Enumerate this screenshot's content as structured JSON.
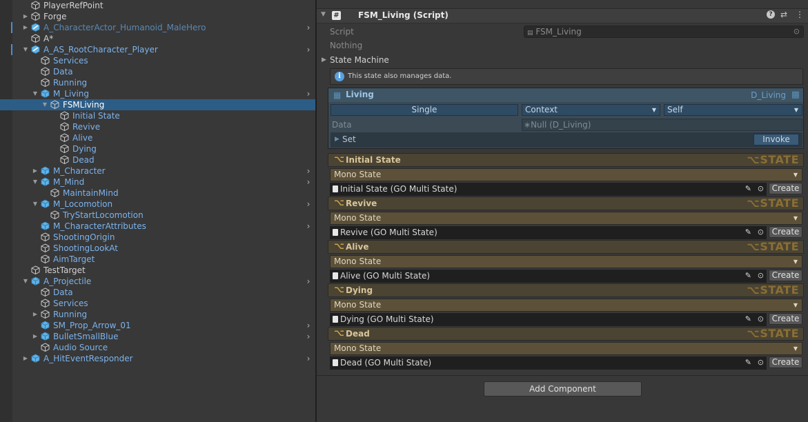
{
  "hierarchy": {
    "rows": [
      {
        "label": "PlayerRefPoint",
        "style": "normal",
        "indent": 0,
        "fold": "",
        "icon": "gameobject",
        "more": false,
        "selected": false,
        "marker": false
      },
      {
        "label": "Forge",
        "style": "normal",
        "indent": 0,
        "fold": "right",
        "icon": "gameobject",
        "more": false,
        "selected": false,
        "marker": false
      },
      {
        "label": "A_CharacterActor_Humanoid_MaleHero",
        "style": "dim",
        "indent": 0,
        "fold": "right",
        "icon": "prefab-variant",
        "more": true,
        "selected": false,
        "marker": true
      },
      {
        "label": "A*",
        "style": "normal",
        "indent": 0,
        "fold": "",
        "icon": "gameobject",
        "more": false,
        "selected": false,
        "marker": false
      },
      {
        "label": "A_AS_RootCharacter_Player",
        "style": "blue",
        "indent": 0,
        "fold": "down",
        "icon": "prefab-variant",
        "more": true,
        "selected": false,
        "marker": true
      },
      {
        "label": "Services",
        "style": "blue",
        "indent": 1,
        "fold": "",
        "icon": "gameobject",
        "more": false,
        "selected": false,
        "marker": false
      },
      {
        "label": "Data",
        "style": "blue",
        "indent": 1,
        "fold": "",
        "icon": "gameobject",
        "more": false,
        "selected": false,
        "marker": false
      },
      {
        "label": "Running",
        "style": "blue",
        "indent": 1,
        "fold": "",
        "icon": "gameobject",
        "more": false,
        "selected": false,
        "marker": false
      },
      {
        "label": "M_Living",
        "style": "blue",
        "indent": 1,
        "fold": "down",
        "icon": "prefab",
        "more": true,
        "selected": false,
        "marker": false
      },
      {
        "label": "FSMLiving",
        "style": "sel",
        "indent": 2,
        "fold": "down",
        "icon": "gameobject",
        "more": false,
        "selected": true,
        "marker": false
      },
      {
        "label": "Initial State",
        "style": "blue",
        "indent": 3,
        "fold": "",
        "icon": "gameobject",
        "more": false,
        "selected": false,
        "marker": false
      },
      {
        "label": "Revive",
        "style": "blue",
        "indent": 3,
        "fold": "",
        "icon": "gameobject",
        "more": false,
        "selected": false,
        "marker": false
      },
      {
        "label": "Alive",
        "style": "blue",
        "indent": 3,
        "fold": "",
        "icon": "gameobject",
        "more": false,
        "selected": false,
        "marker": false
      },
      {
        "label": "Dying",
        "style": "blue",
        "indent": 3,
        "fold": "",
        "icon": "gameobject",
        "more": false,
        "selected": false,
        "marker": false
      },
      {
        "label": "Dead",
        "style": "blue",
        "indent": 3,
        "fold": "",
        "icon": "gameobject",
        "more": false,
        "selected": false,
        "marker": false
      },
      {
        "label": "M_Character",
        "style": "blue",
        "indent": 1,
        "fold": "right",
        "icon": "prefab",
        "more": true,
        "selected": false,
        "marker": false
      },
      {
        "label": "M_Mind",
        "style": "blue",
        "indent": 1,
        "fold": "down",
        "icon": "prefab",
        "more": true,
        "selected": false,
        "marker": false
      },
      {
        "label": "MaintainMind",
        "style": "blue",
        "indent": 2,
        "fold": "",
        "icon": "gameobject",
        "more": false,
        "selected": false,
        "marker": false
      },
      {
        "label": "M_Locomotion",
        "style": "blue",
        "indent": 1,
        "fold": "down",
        "icon": "prefab",
        "more": true,
        "selected": false,
        "marker": false
      },
      {
        "label": "TryStartLocomotion",
        "style": "blue",
        "indent": 2,
        "fold": "",
        "icon": "gameobject",
        "more": false,
        "selected": false,
        "marker": false
      },
      {
        "label": "M_CharacterAttributes",
        "style": "blue",
        "indent": 1,
        "fold": "",
        "icon": "prefab",
        "more": true,
        "selected": false,
        "marker": false
      },
      {
        "label": "ShootingOrigin",
        "style": "blue",
        "indent": 1,
        "fold": "",
        "icon": "gameobject",
        "more": false,
        "selected": false,
        "marker": false
      },
      {
        "label": "ShootingLookAt",
        "style": "blue",
        "indent": 1,
        "fold": "",
        "icon": "gameobject",
        "more": false,
        "selected": false,
        "marker": false
      },
      {
        "label": "AimTarget",
        "style": "blue",
        "indent": 1,
        "fold": "",
        "icon": "gameobject",
        "more": false,
        "selected": false,
        "marker": false
      },
      {
        "label": "TestTarget",
        "style": "normal",
        "indent": 0,
        "fold": "",
        "icon": "gameobject",
        "more": false,
        "selected": false,
        "marker": false
      },
      {
        "label": "A_Projectile",
        "style": "blue",
        "indent": 0,
        "fold": "down",
        "icon": "prefab",
        "more": true,
        "selected": false,
        "marker": false
      },
      {
        "label": "Data",
        "style": "blue",
        "indent": 1,
        "fold": "",
        "icon": "gameobject",
        "more": false,
        "selected": false,
        "marker": false
      },
      {
        "label": "Services",
        "style": "blue",
        "indent": 1,
        "fold": "",
        "icon": "gameobject",
        "more": false,
        "selected": false,
        "marker": false
      },
      {
        "label": "Running",
        "style": "blue",
        "indent": 1,
        "fold": "right",
        "icon": "gameobject",
        "more": false,
        "selected": false,
        "marker": false
      },
      {
        "label": "SM_Prop_Arrow_01",
        "style": "blue",
        "indent": 1,
        "fold": "",
        "icon": "prefab",
        "more": true,
        "selected": false,
        "marker": false
      },
      {
        "label": "BulletSmallBlue",
        "style": "blue",
        "indent": 1,
        "fold": "right",
        "icon": "prefab",
        "more": true,
        "selected": false,
        "marker": false
      },
      {
        "label": "Audio Source",
        "style": "blue",
        "indent": 1,
        "fold": "",
        "icon": "gameobject",
        "more": false,
        "selected": false,
        "marker": false
      },
      {
        "label": "A_HitEventResponder",
        "style": "blue",
        "indent": 0,
        "fold": "right",
        "icon": "prefab",
        "more": true,
        "selected": false,
        "marker": false
      }
    ]
  },
  "component": {
    "title": "FSM_Living (Script)",
    "script_label": "Script",
    "script_value": "FSM_Living",
    "nothing_label": "Nothing",
    "state_machine_label": "State Machine",
    "info_text": "This state also manages data."
  },
  "living": {
    "title": "Living",
    "data_type": "D_Living",
    "single_label": "Single",
    "context_label": "Context",
    "self_label": "Self",
    "data_label": "Data",
    "data_value": "Null (D_Living)",
    "set_label": "Set",
    "invoke_label": "Invoke"
  },
  "states": [
    {
      "title": "Initial State",
      "tag": "⌥STATE",
      "mode": "Mono State",
      "asset": "Initial State (GO Multi State)",
      "create": "Create"
    },
    {
      "title": "Revive",
      "tag": "⌥STATE",
      "mode": "Mono State",
      "asset": "Revive (GO Multi State)",
      "create": "Create"
    },
    {
      "title": "Alive",
      "tag": "⌥STATE",
      "mode": "Mono State",
      "asset": "Alive (GO Multi State)",
      "create": "Create"
    },
    {
      "title": "Dying",
      "tag": "⌥STATE",
      "mode": "Mono State",
      "asset": "Dying (GO Multi State)",
      "create": "Create"
    },
    {
      "title": "Dead",
      "tag": "⌥STATE",
      "mode": "Mono State",
      "asset": "Dead (GO Multi State)",
      "create": "Create"
    }
  ],
  "add_component_label": "Add Component",
  "colors": {
    "selection": "#2c5d87",
    "prefab_blue": "#7cb3ec",
    "state_header": "#4b4433",
    "state_gold": "#8a6f35"
  }
}
